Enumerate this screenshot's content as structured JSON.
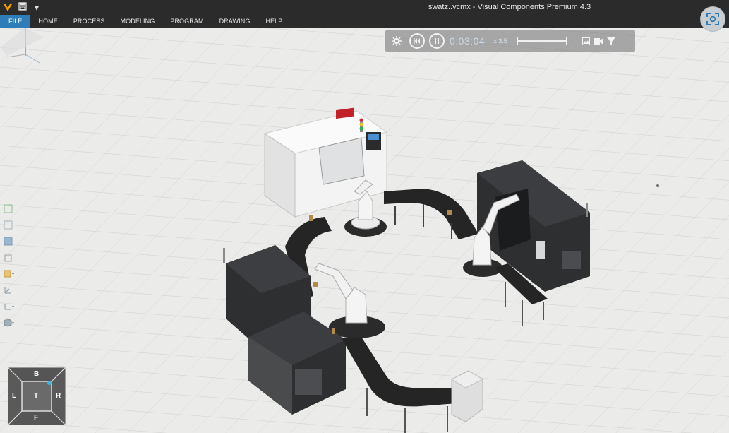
{
  "window": {
    "title": "swatz..vcmx - Visual Components Premium 4.3",
    "quick_access_dropdown": "▾"
  },
  "menu": {
    "items": [
      "FILE",
      "HOME",
      "PROCESS",
      "MODELING",
      "PROGRAM",
      "DRAWING",
      "HELP"
    ],
    "active": "FILE"
  },
  "simulation": {
    "time": "0:03:04",
    "speed": "x 3.5"
  },
  "navcube": {
    "top": "B",
    "left": "L",
    "center": "T",
    "right": "R",
    "bottom": "F"
  },
  "icons": {
    "logo": "visual-components-logo",
    "save": "save-icon",
    "settings": "gear-icon",
    "reset": "reset-icon",
    "pause": "pause-icon",
    "snapshot": "image-icon",
    "record": "camera-icon",
    "filter": "filter-icon",
    "screenshot": "screenshot-icon"
  },
  "colors": {
    "titlebar": "#2b2b2b",
    "active_menu": "#2f7db8",
    "floor": "#e8e8e6",
    "machine_dark": "#2a2c2e",
    "machine_white": "#f2f2f2",
    "conveyor": "#262626"
  }
}
